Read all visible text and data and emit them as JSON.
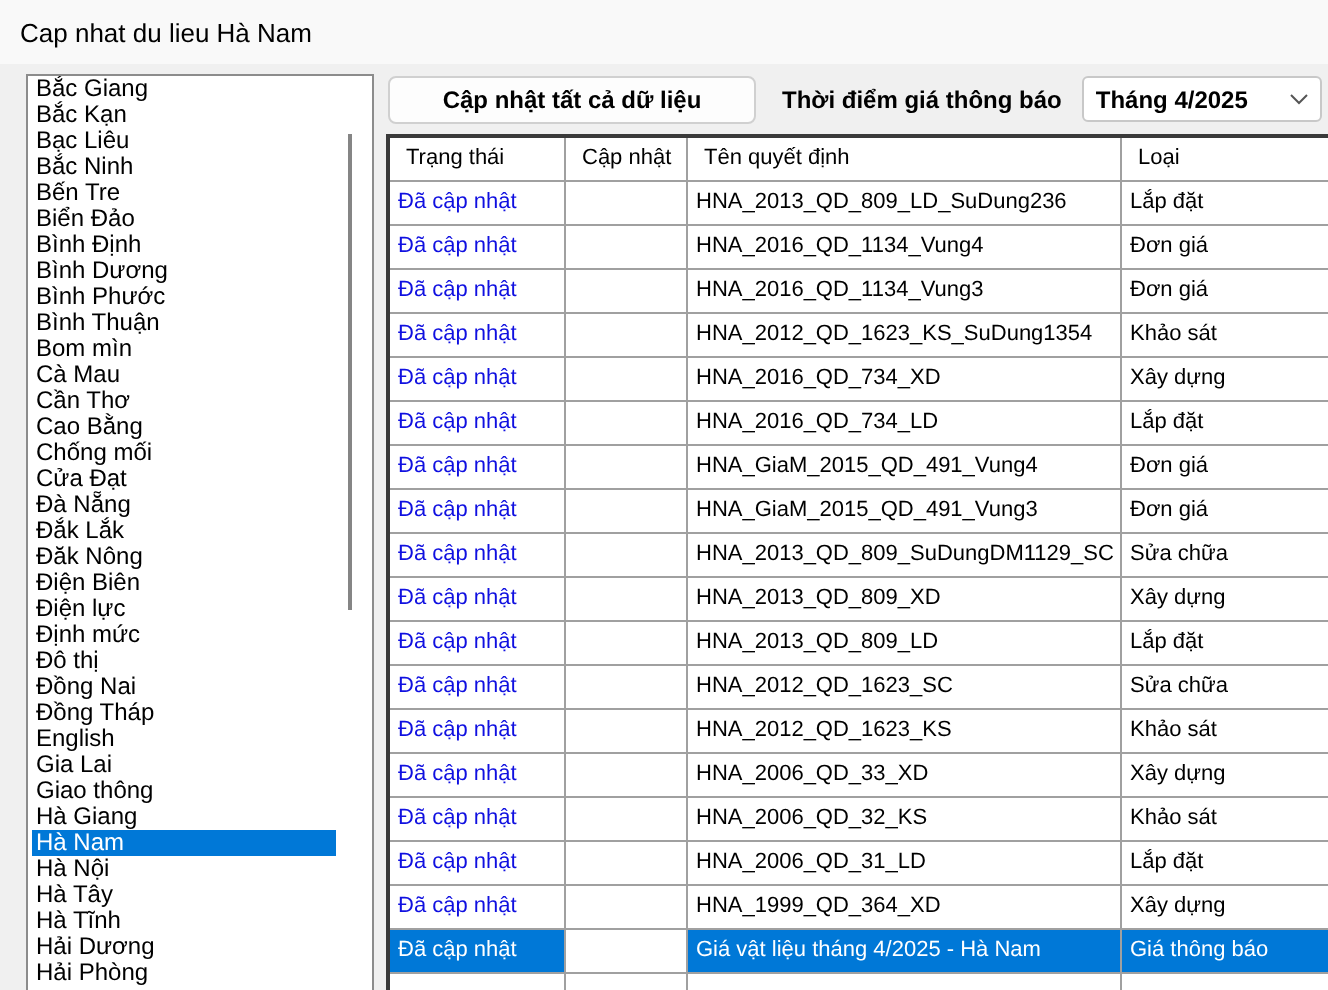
{
  "window": {
    "title": "Cap nhat du lieu Hà Nam"
  },
  "provinces": [
    {
      "label": "Bắc Giang",
      "selected": false
    },
    {
      "label": "Bắc Kạn",
      "selected": false
    },
    {
      "label": "Bạc Liêu",
      "selected": false
    },
    {
      "label": "Bắc Ninh",
      "selected": false
    },
    {
      "label": "Bến Tre",
      "selected": false
    },
    {
      "label": "Biển Đảo",
      "selected": false
    },
    {
      "label": "Bình Định",
      "selected": false
    },
    {
      "label": "Bình Dương",
      "selected": false
    },
    {
      "label": "Bình Phước",
      "selected": false
    },
    {
      "label": "Bình Thuận",
      "selected": false
    },
    {
      "label": "Bom mìn",
      "selected": false
    },
    {
      "label": "Cà Mau",
      "selected": false
    },
    {
      "label": "Cần Thơ",
      "selected": false
    },
    {
      "label": "Cao Bằng",
      "selected": false
    },
    {
      "label": "Chống mối",
      "selected": false
    },
    {
      "label": "Cửa Đạt",
      "selected": false
    },
    {
      "label": "Đà Nẵng",
      "selected": false
    },
    {
      "label": "Đắk Lắk",
      "selected": false
    },
    {
      "label": "Đăk Nông",
      "selected": false
    },
    {
      "label": "Điện Biên",
      "selected": false
    },
    {
      "label": "Điện lực",
      "selected": false
    },
    {
      "label": "Định mức",
      "selected": false
    },
    {
      "label": "Đô thị",
      "selected": false
    },
    {
      "label": "Đồng Nai",
      "selected": false
    },
    {
      "label": "Đồng Tháp",
      "selected": false
    },
    {
      "label": "English",
      "selected": false
    },
    {
      "label": "Gia Lai",
      "selected": false
    },
    {
      "label": "Giao thông",
      "selected": false
    },
    {
      "label": "Hà Giang",
      "selected": false
    },
    {
      "label": "Hà Nam",
      "selected": true
    },
    {
      "label": "Hà Nội",
      "selected": false
    },
    {
      "label": "Hà Tây",
      "selected": false
    },
    {
      "label": "Hà Tĩnh",
      "selected": false
    },
    {
      "label": "Hải Dương",
      "selected": false
    },
    {
      "label": "Hải Phòng",
      "selected": false
    }
  ],
  "update_all_button": "Cập nhật tất cả dữ liệu",
  "price_time": {
    "label": "Thời điểm giá thông báo",
    "value": "Tháng 4/2025"
  },
  "table": {
    "columns": [
      "Trạng thái",
      "Cập nhật",
      "Tên quyết định",
      "Loại"
    ],
    "rows": [
      {
        "status": "Đã cập nhật",
        "name": "HNA_2013_QD_809_LD_SuDung236",
        "type": "Lắp đặt",
        "selected": false
      },
      {
        "status": "Đã cập nhật",
        "name": "HNA_2016_QD_1134_Vung4",
        "type": "Đơn giá",
        "selected": false
      },
      {
        "status": "Đã cập nhật",
        "name": "HNA_2016_QD_1134_Vung3",
        "type": "Đơn giá",
        "selected": false
      },
      {
        "status": "Đã cập nhật",
        "name": "HNA_2012_QD_1623_KS_SuDung1354",
        "type": "Khảo sát",
        "selected": false
      },
      {
        "status": "Đã cập nhật",
        "name": "HNA_2016_QD_734_XD",
        "type": "Xây dựng",
        "selected": false
      },
      {
        "status": "Đã cập nhật",
        "name": "HNA_2016_QD_734_LD",
        "type": "Lắp đặt",
        "selected": false
      },
      {
        "status": "Đã cập nhật",
        "name": "HNA_GiaM_2015_QD_491_Vung4",
        "type": "Đơn giá",
        "selected": false
      },
      {
        "status": "Đã cập nhật",
        "name": "HNA_GiaM_2015_QD_491_Vung3",
        "type": "Đơn giá",
        "selected": false
      },
      {
        "status": "Đã cập nhật",
        "name": "HNA_2013_QD_809_SuDungDM1129_SC",
        "type": "Sửa chữa",
        "selected": false
      },
      {
        "status": "Đã cập nhật",
        "name": "HNA_2013_QD_809_XD",
        "type": "Xây dựng",
        "selected": false
      },
      {
        "status": "Đã cập nhật",
        "name": "HNA_2013_QD_809_LD",
        "type": "Lắp đặt",
        "selected": false
      },
      {
        "status": "Đã cập nhật",
        "name": "HNA_2012_QD_1623_SC",
        "type": "Sửa chữa",
        "selected": false
      },
      {
        "status": "Đã cập nhật",
        "name": "HNA_2012_QD_1623_KS",
        "type": "Khảo sát",
        "selected": false
      },
      {
        "status": "Đã cập nhật",
        "name": "HNA_2006_QD_33_XD",
        "type": "Xây dựng",
        "selected": false
      },
      {
        "status": "Đã cập nhật",
        "name": "HNA_2006_QD_32_KS",
        "type": "Khảo sát",
        "selected": false
      },
      {
        "status": "Đã cập nhật",
        "name": "HNA_2006_QD_31_LD",
        "type": "Lắp đặt",
        "selected": false
      },
      {
        "status": "Đã cập nhật",
        "name": "HNA_1999_QD_364_XD",
        "type": "Xây dựng",
        "selected": false
      },
      {
        "status": "Đã cập nhật",
        "name": "Giá vật liệu tháng 4/2025 - Hà Nam",
        "type": "Giá thông báo",
        "selected": true
      }
    ]
  }
}
